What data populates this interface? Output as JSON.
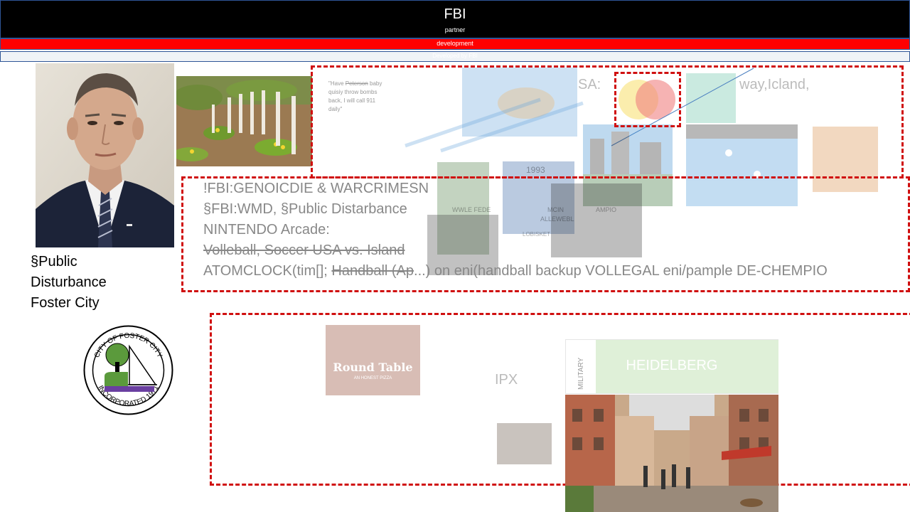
{
  "header": {
    "title": "FBI",
    "subtitle": "partner",
    "dev_label": "development",
    "thin_label": "Developed by FBI"
  },
  "left_caption": {
    "line1": "§Public",
    "line2": "Disturbance",
    "line3": "Foster City"
  },
  "seal": {
    "top_text": "CITY OF FOSTER CITY",
    "bottom_text": "INCORPORATED 1971"
  },
  "quote": {
    "strike_word": "Peterson",
    "lines": [
      "\"Have ",
      " baby",
      "quisiy throw bombs",
      "back, I will call 911",
      "daily\""
    ]
  },
  "top_fragments": {
    "sa": "SA:",
    "way": "way,Icland,"
  },
  "arcade_overlay": {
    "left_label": "WWLE FEDE",
    "mid_label": "MCIN",
    "right_label": "AMPIO",
    "sub1": "ALLEWEBL",
    "sub2": "LOBISKET",
    "year": "1993"
  },
  "middle_text": {
    "line1": "!FBI:GENOICDIE & WARCRIMESN",
    "line2": "§FBI:WMD, §Public Distarbance",
    "line3": "NINTENDO Arcade:",
    "line4": "  Volleball, Soccer USA vs. Island",
    "line5_prefix": "ATOMCLOCK(tim[]; ",
    "line5_strike": "Handball  (Ap",
    "line5_rest": "...)  on eni(handball backup VOLLEGAL eni/pample DE-CHEMPIO"
  },
  "bottom_box": {
    "roundtable_title": "Round Table",
    "roundtable_sub": "AN HONEST PIZZA",
    "ipx": "IPX",
    "military": "MILITARY",
    "heidelberg": "HEIDELBERG"
  },
  "colors": {
    "header_bg": "#000000",
    "dev_bar": "#ff0000",
    "dash": "#d01010",
    "seal_green": "#5b9a3c",
    "seal_purple": "#6a3fa0"
  }
}
